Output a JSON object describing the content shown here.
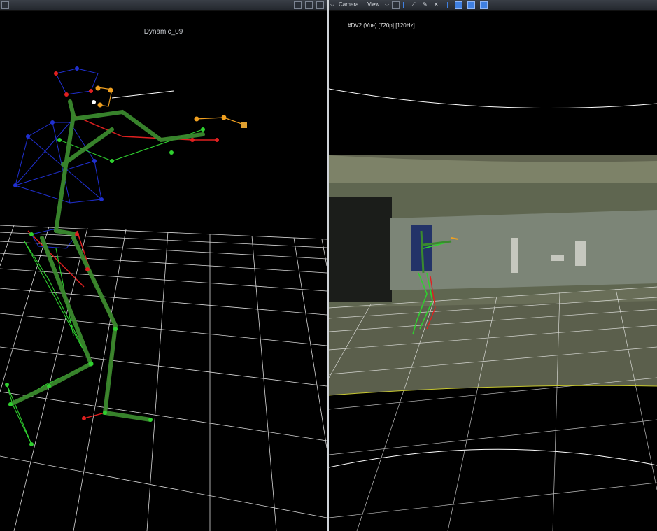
{
  "left_view": {
    "title": "Dynamic_09"
  },
  "right_view": {
    "toolbar": {
      "camera_menu": "Camera",
      "view_menu": "View"
    },
    "camera_info": "#DV2 (Vue) [720p] [120Hz]"
  },
  "colors": {
    "bone": "#3a8a2e",
    "left_marker": "#2fd02f",
    "right_marker": "#e02020",
    "torso_marker": "#1f2fd0",
    "prop_marker": "#f0a020",
    "grid": "#ffffff",
    "accent": "#3f7fe0"
  }
}
